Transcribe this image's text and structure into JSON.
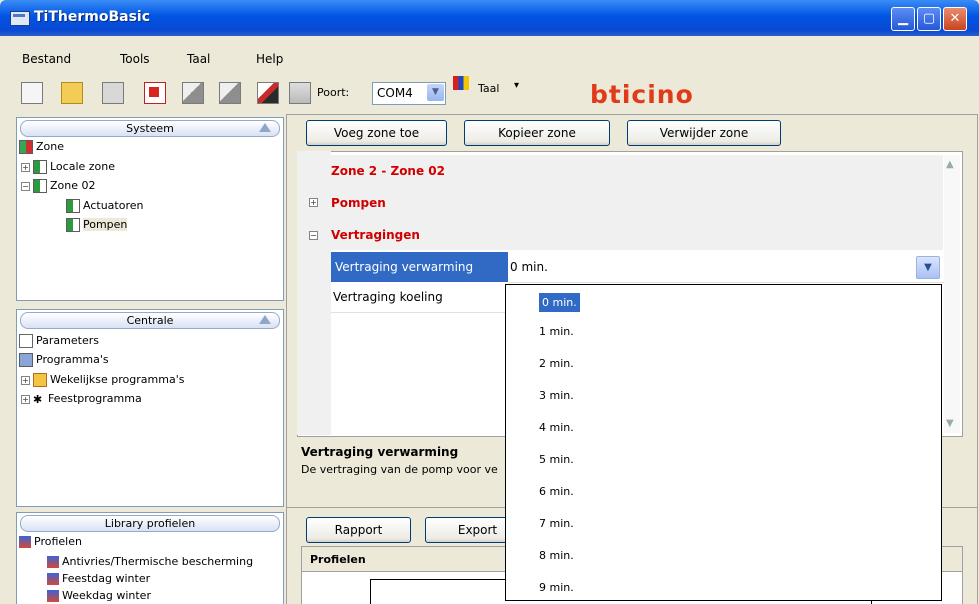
{
  "window": {
    "title": "TiThermoBasic"
  },
  "menu": [
    "Bestand",
    "Tools",
    "Taal",
    "Help"
  ],
  "toolbar": {
    "port_label": "Poort:",
    "port_value": "COM4",
    "lang_value": "Taal",
    "brand": "bticino"
  },
  "panels": {
    "systeem": {
      "title": "Systeem",
      "items": [
        "Zone",
        "Locale zone",
        "Zone 02",
        "Actuatoren",
        "Pompen"
      ]
    },
    "centrale": {
      "title": "Centrale",
      "items": [
        "Parameters",
        "Programma's",
        "Wekelijkse programma's",
        "Feestprogramma"
      ]
    },
    "library": {
      "title": "Library profielen",
      "items": [
        "Profielen",
        "Antivries/Thermische bescherming",
        "Feestdag winter",
        "Weekdag winter"
      ]
    }
  },
  "zone_buttons": {
    "add": "Voeg zone toe",
    "copy": "Kopieer zone",
    "delete": "Verwijder zone"
  },
  "property_grid": {
    "zone_title": "Zone 2 - Zone 02",
    "category_pumps": "Pompen",
    "category_delays": "Vertragingen",
    "rows": [
      {
        "name": "Vertraging verwarming",
        "value": "0 min."
      },
      {
        "name": "Vertraging koeling",
        "value": ""
      }
    ]
  },
  "description": {
    "title": "Vertraging verwarming",
    "text": "De vertraging van de pomp voor ve"
  },
  "dropdown_options": [
    "0 min.",
    "1 min.",
    "2 min.",
    "3 min.",
    "4 min.",
    "5 min.",
    "6 min.",
    "7 min.",
    "8 min.",
    "9 min."
  ],
  "lower_buttons": {
    "report": "Rapport",
    "export": "Export"
  },
  "lower_header": "Profielen"
}
